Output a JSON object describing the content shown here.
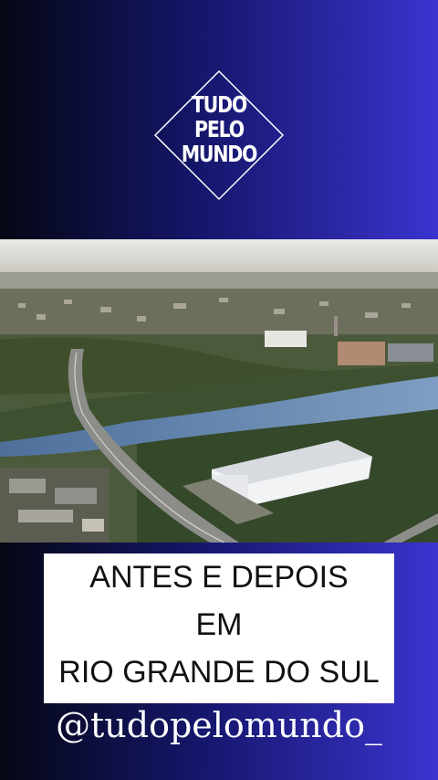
{
  "logo": {
    "lines": [
      "TUDO",
      "PELO",
      "MUNDO"
    ]
  },
  "photo": {
    "description_icon": "aerial-city-river-image"
  },
  "caption": {
    "lines": [
      "ANTES E DEPOIS",
      "EM",
      "RIO GRANDE DO SUL"
    ]
  },
  "handle": "@tudopelomundo_",
  "colors": {
    "gradient_left": "#050714",
    "gradient_right": "#3a34cf",
    "caption_bg": "#ffffff"
  }
}
